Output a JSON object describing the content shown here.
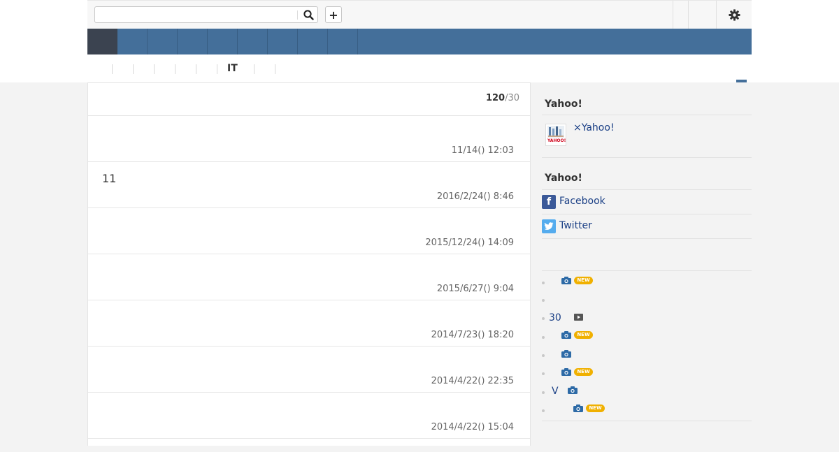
{
  "search": {
    "placeholder": ""
  },
  "toolbar": {
    "add_label": "+"
  },
  "subnav": {
    "label": "IT"
  },
  "main": {
    "count_bold": "120",
    "count_rest": "/30",
    "rows": [
      {
        "title": "",
        "date": "11/14() 12:03"
      },
      {
        "title": "11",
        "date": "2016/2/24() 8:46"
      },
      {
        "title": "",
        "date": "2015/12/24() 14:09"
      },
      {
        "title": "",
        "date": "2015/6/27() 9:04"
      },
      {
        "title": "",
        "date": "2014/7/23() 18:20"
      },
      {
        "title": "",
        "date": "2014/4/22() 22:35"
      },
      {
        "title": "",
        "date": "2014/4/22() 15:04"
      }
    ]
  },
  "sidebar": {
    "heading1": "Yahoo!",
    "feature_link": "×Yahoo!",
    "thumb_caption": "YAHOO!",
    "heading2": "Yahoo!",
    "facebook_label": "Facebook",
    "twitter_label": "Twitter",
    "list": [
      {
        "text": "",
        "icon": "camera-icon",
        "new": "NEW"
      },
      {
        "text": "",
        "icon": "",
        "new": ""
      },
      {
        "text": "30",
        "icon": "video-icon",
        "new": ""
      },
      {
        "text": "",
        "icon": "camera-icon",
        "new": "NEW"
      },
      {
        "text": "",
        "icon": "camera-icon",
        "new": ""
      },
      {
        "text": "",
        "icon": "camera-icon",
        "new": "NEW"
      },
      {
        "text": "V",
        "icon": "camera-icon",
        "new": ""
      },
      {
        "text": "",
        "icon": "camera-icon",
        "new": "NEW"
      }
    ]
  },
  "colors": {
    "nav": "#446f9a",
    "nav_home": "#3b4350",
    "link": "#1a3f85",
    "badge": "#f0b000"
  }
}
